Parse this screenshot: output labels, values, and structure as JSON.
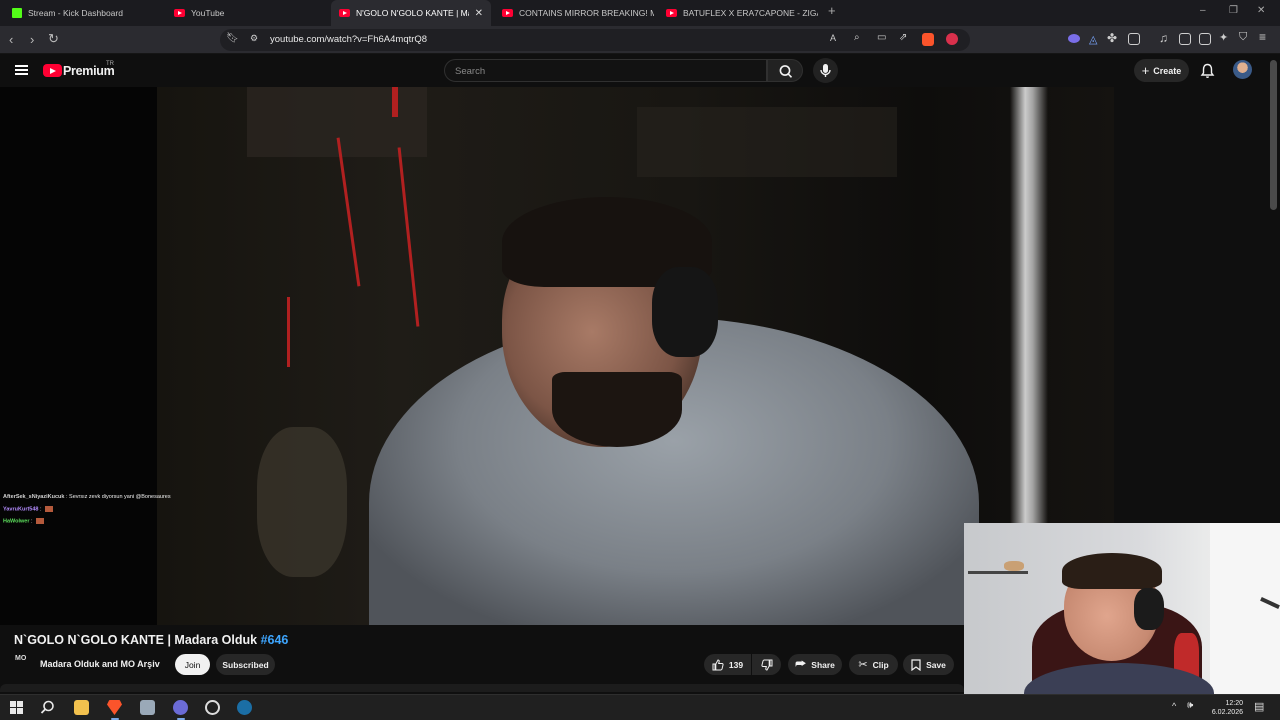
{
  "browser": {
    "tabs": [
      {
        "label": "Stream - Kick Dashboard",
        "icon": "kick-icon"
      },
      {
        "label": "YouTube",
        "icon": "youtube-icon"
      },
      {
        "label": "N'GOLO N'GOLO KANTE | Mada",
        "icon": "youtube-icon",
        "active": true
      },
      {
        "label": "CONTAINS MIRROR BREAKING! Mot",
        "icon": "youtube-icon"
      },
      {
        "label": "BATUFLEX X ERA7CAPONE - ZIGA",
        "icon": "youtube-icon"
      }
    ],
    "url": "youtube.com/watch?v=Fh6A4mqtrQ8"
  },
  "masthead": {
    "brand": "Premium",
    "country": "TR",
    "search_placeholder": "Search",
    "create_label": "Create"
  },
  "overlay_chat": [
    {
      "user": "AfterSek_sNiyaziKucuk",
      "message": ": Sevrsız zevk diyorsun yani @Bonesaures"
    },
    {
      "user": "YavruKurt548",
      "message": ":"
    },
    {
      "user": "HaWolwer",
      "message": ":"
    }
  ],
  "video": {
    "title": "N`GOLO N`GOLO KANTE | Madara Olduk",
    "hashtag": "#646",
    "channel_logo": "MO",
    "channel": "Madara Olduk and MO Arşiv",
    "join_label": "Join",
    "subscribed_label": "Subscribed",
    "likes": "139",
    "share_label": "Share",
    "clip_label": "Clip",
    "save_label": "Save"
  },
  "taskbar": {
    "time": "12:20",
    "date": "6.02.2026"
  },
  "colors": {
    "youtube_red": "#ff0033",
    "kick_green": "#53fc18",
    "hashtag_blue": "#3ea6ff"
  }
}
